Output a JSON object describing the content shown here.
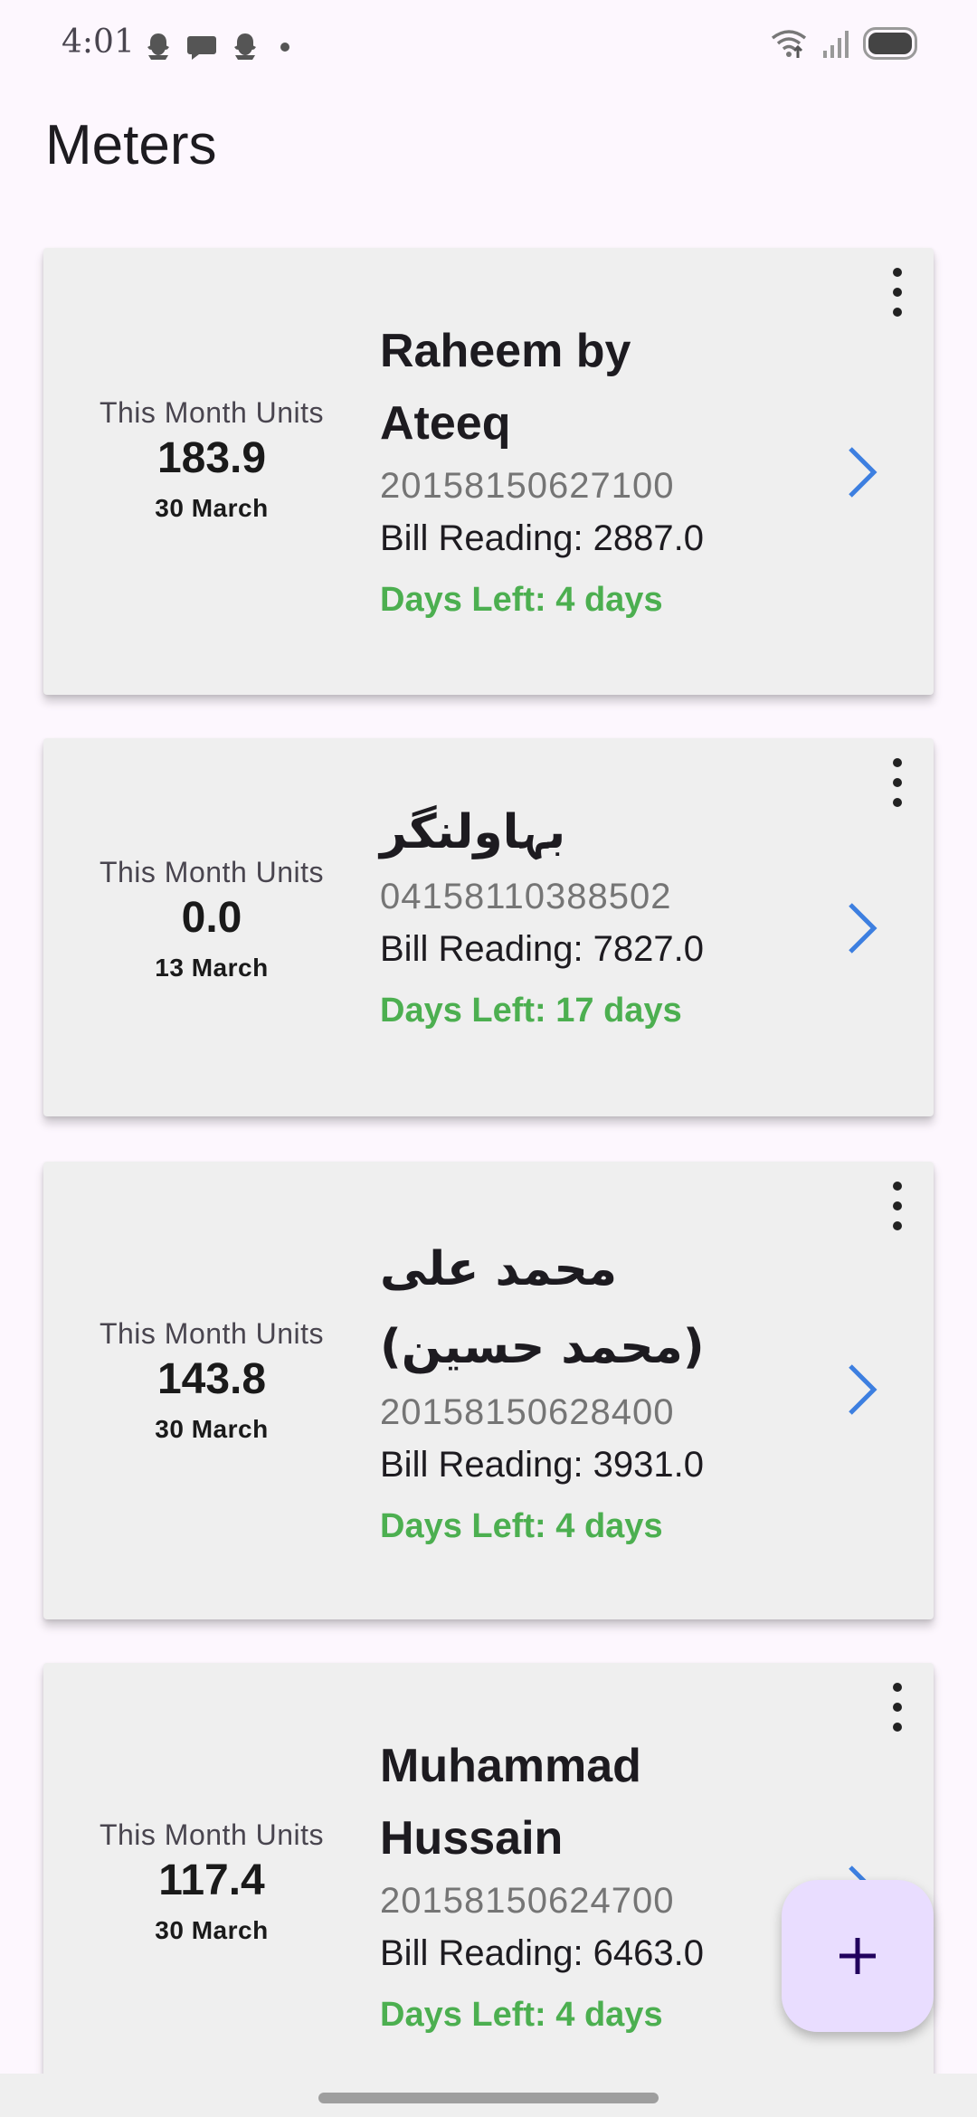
{
  "status_bar": {
    "time": "4:01",
    "notification_icons": [
      "snapchat-icon",
      "chat-icon",
      "snapchat-icon",
      "dot-icon"
    ],
    "system_icons": [
      "wifi-icon",
      "signal-icon",
      "battery-icon"
    ]
  },
  "page": {
    "title": "Meters"
  },
  "meters": [
    {
      "units_label": "This Month Units",
      "units_value": "183.9",
      "date": "30 March",
      "name": "Raheem by Ateeq",
      "meter_number": "20158150627100",
      "bill_reading": "Bill Reading: 2887.0",
      "days_left": "Days Left: 4 days"
    },
    {
      "units_label": "This Month Units",
      "units_value": "0.0",
      "date": "13 March",
      "name": "بہاولنگر",
      "meter_number": "04158110388502",
      "bill_reading": "Bill Reading: 7827.0",
      "days_left": "Days Left: 17 days"
    },
    {
      "units_label": "This Month Units",
      "units_value": "143.8",
      "date": "30 March",
      "name": "محمد علی (محمد حسین)",
      "meter_number": "20158150628400",
      "bill_reading": "Bill Reading: 3931.0",
      "days_left": "Days Left: 4 days"
    },
    {
      "units_label": "This Month Units",
      "units_value": "117.4",
      "date": "30 March",
      "name": "Muhammad Hussain",
      "meter_number": "20158150624700",
      "bill_reading": "Bill Reading: 6463.0",
      "days_left": "Days Left: 4 days"
    }
  ],
  "colors": {
    "days_left": "#4caf50",
    "chevron": "#3d7fe0",
    "fab_background": "#e9ddff",
    "card_background": "#efefef"
  },
  "fab": {
    "icon": "plus-icon"
  }
}
